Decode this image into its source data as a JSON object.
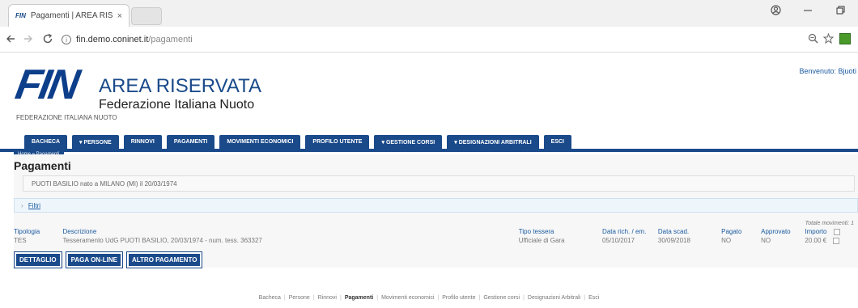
{
  "browser": {
    "tab_title": "Pagamenti | AREA RISER",
    "tab_favicon": "FIN",
    "close_glyph": "×",
    "url_host": "fin.demo.coninet.it",
    "url_path": "/pagamenti",
    "info_glyph": "i"
  },
  "header": {
    "logo_text": "FIN",
    "logo_sub": "FEDERAZIONE ITALIANA NUOTO",
    "area_title": "AREA RISERVATA",
    "area_sub": "Federazione Italiana Nuoto",
    "welcome": "Benvenuto: Bjuoti"
  },
  "menu": [
    {
      "label": "BACHECA"
    },
    {
      "label": "▾ PERSONE"
    },
    {
      "label": "RINNOVI"
    },
    {
      "label": "PAGAMENTI"
    },
    {
      "label": "MOVIMENTI ECONOMICI"
    },
    {
      "label": "PROFILO UTENTE"
    },
    {
      "label": "▾ GESTIONE CORSI"
    },
    {
      "label": "▾ DESIGNAZIONI ARBITRALI"
    },
    {
      "label": "ESCI"
    }
  ],
  "breadcrumb": "Home » Pagamenti",
  "main": {
    "title": "Pagamenti",
    "person": "PUOTI BASILIO nato a MILANO (MI) il 20/03/1974",
    "filter_arrow": "›",
    "filter_label": "Filtri",
    "totals": "Totale movimenti: 1",
    "columns": {
      "tipologia": "Tipologia",
      "descrizione": "Descrizione",
      "tipo_tesseramento": "Tipo tessera",
      "data_rich": "Data rich. / em.",
      "data_scad": "Data scad.",
      "pagato": "Pagato",
      "approvato": "Approvato",
      "importo": "Importo"
    },
    "rows": [
      {
        "tipologia": "TES",
        "descrizione": "Tesseramento UdG PUOTI BASILIO, 20/03/1974 - num. tess. 363327",
        "tipo_tesseramento": "Ufficiale di Gara",
        "data_rich": "05/10/2017",
        "data_scad": "30/09/2018",
        "pagato": "NO",
        "approvato": "NO",
        "importo": "20.00 €"
      }
    ],
    "buttons": {
      "dettaglio": "DETTAGLIO",
      "paga": "PAGA ON-LINE",
      "altro": "ALTRO PAGAMENTO"
    }
  },
  "footer": [
    "Bacheca",
    "Persone",
    "Rinnovi",
    "Pagamenti",
    "Movimenti economici",
    "Profilo utente",
    "Gestione corsi",
    "Designazioni Arbitrali",
    "Esci"
  ],
  "footer_active": "Pagamenti"
}
